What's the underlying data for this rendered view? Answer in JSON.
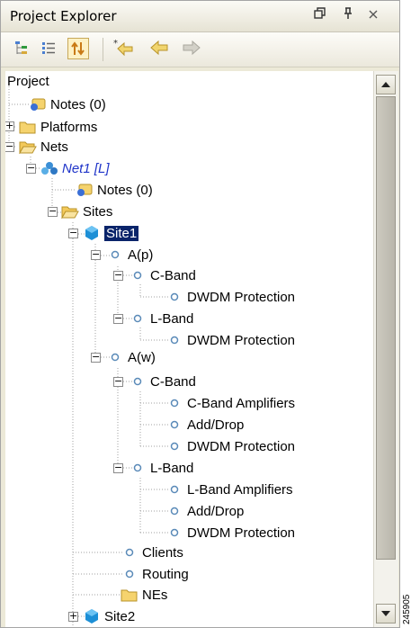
{
  "window": {
    "title": "Project Explorer",
    "controls": {
      "restore_icon": "restore-icon",
      "pin_icon": "pin-icon",
      "close_icon": "close-icon"
    }
  },
  "toolbar": {
    "icons": [
      "tree-view-icon",
      "list-view-icon",
      "sync-icon",
      "new-arrow-icon",
      "back-arrow-icon",
      "forward-arrow-icon"
    ]
  },
  "tree": {
    "root": "Project",
    "notes": "Notes (0)",
    "platforms": "Platforms",
    "nets": "Nets",
    "net1": "Net1 [L]",
    "net_notes": "Notes (0)",
    "sites": "Sites",
    "site1": "Site1",
    "a_p": "A(p)",
    "a_p_cband": "C-Band",
    "a_p_cband_dwdm": "DWDM Protection",
    "a_p_lband": "L-Band",
    "a_p_lband_dwdm": "DWDM Protection",
    "a_w": "A(w)",
    "a_w_cband": "C-Band",
    "a_w_cband_amp": "C-Band Amplifiers",
    "a_w_cband_adddrop": "Add/Drop",
    "a_w_cband_dwdm": "DWDM Protection",
    "a_w_lband": "L-Band",
    "a_w_lband_amp": "L-Band Amplifiers",
    "a_w_lband_adddrop": "Add/Drop",
    "a_w_lband_dwdm": "DWDM Protection",
    "clients": "Clients",
    "routing": "Routing",
    "nes": "NEs",
    "site2": "Site2"
  },
  "figure_ref": "245905",
  "colors": {
    "selection": "#0a246a",
    "net_link": "#1f34c9",
    "folder": "#f5d36e",
    "site_cube": "#1d8fd6"
  }
}
